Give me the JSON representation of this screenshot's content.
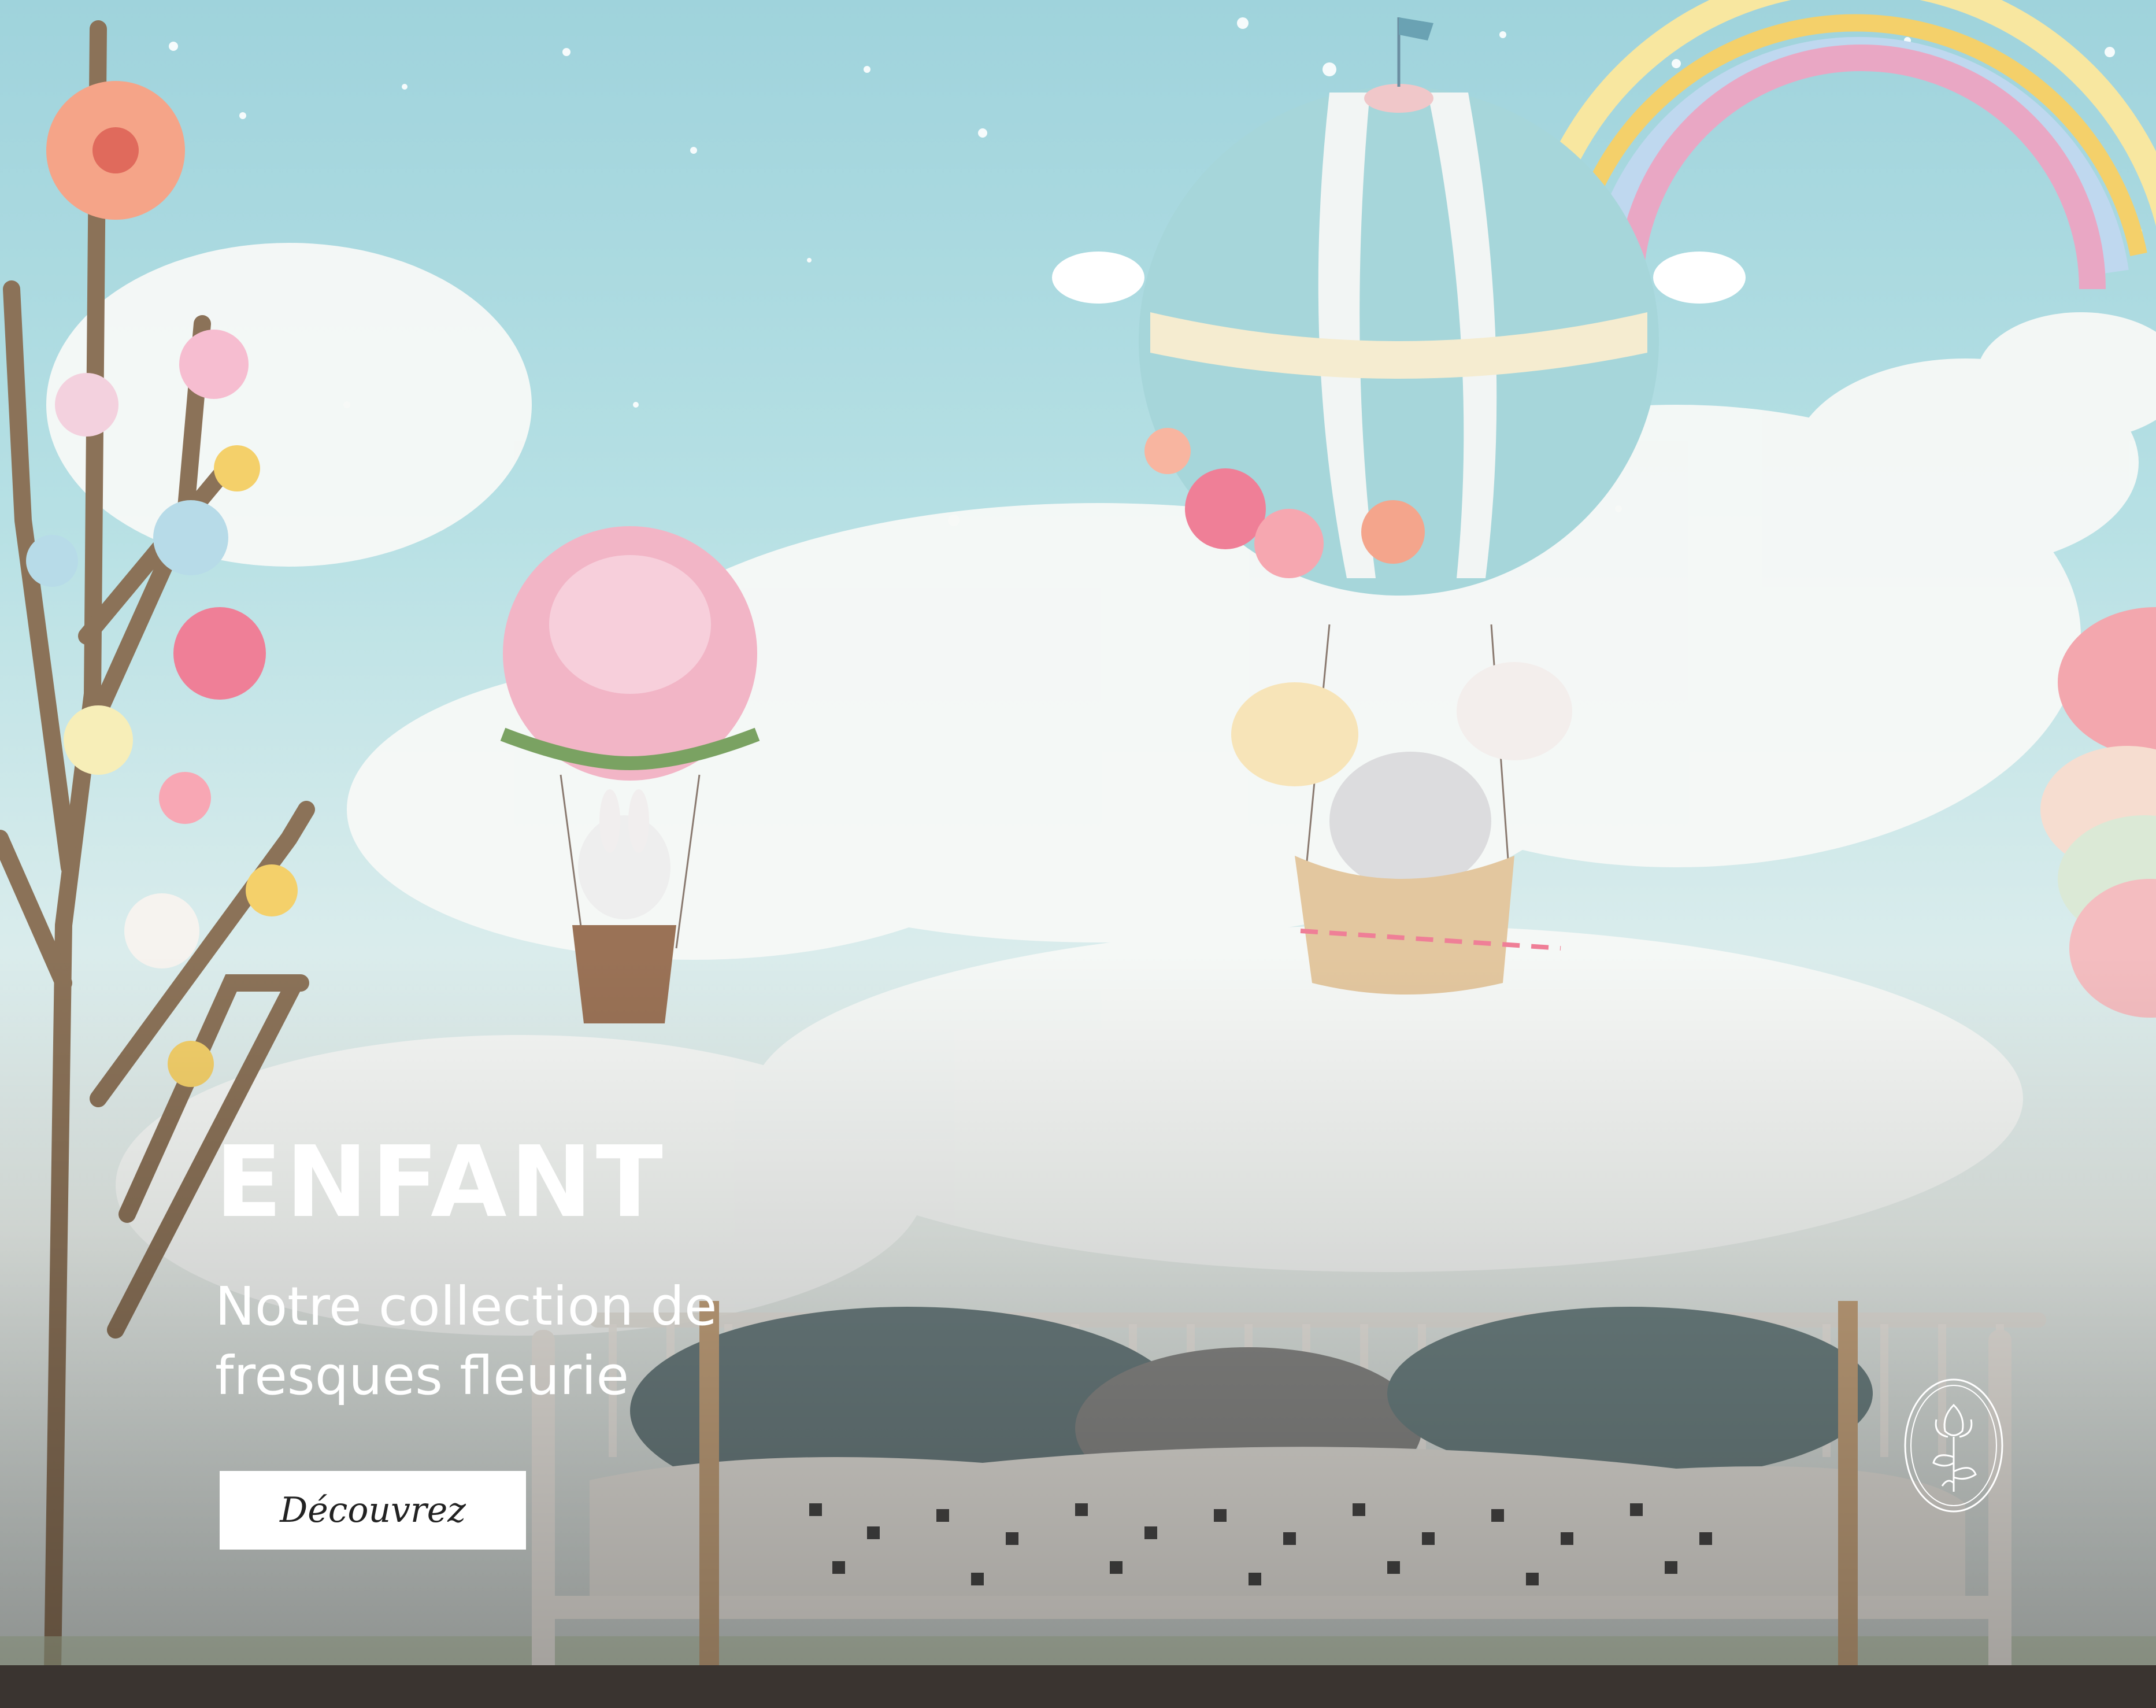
{
  "hero": {
    "title": "ENFANT",
    "subtitle_line1": "Notre collection de",
    "subtitle_line2": "fresques fleurie",
    "cta_label": "Découvrez"
  },
  "brand": {
    "logo_icon": "magnolia-flower-oval-logo-icon"
  },
  "colors": {
    "sky": "#a9dbe0",
    "cloud": "#f6f8f6",
    "text": "#ffffff",
    "button_bg": "#ffffff",
    "button_text": "#222222",
    "balloon_blue": "#9fd3d8",
    "balloon_pink": "#f2b5c6"
  }
}
